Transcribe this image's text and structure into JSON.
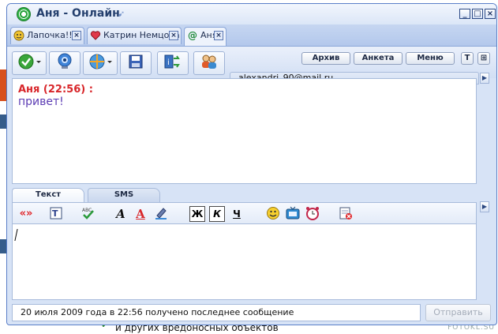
{
  "window": {
    "title": "Аня - Онлайн",
    "controls": [
      "_",
      "□",
      "×"
    ]
  },
  "tabs": [
    {
      "label": "Лапочка!!!",
      "icon": "smiley-status-icon"
    },
    {
      "label": "Катрин Немцова",
      "icon": "heart-status-icon"
    },
    {
      "label": "Аня",
      "icon": "at-status-icon",
      "active": true
    }
  ],
  "toolbar": {
    "buttons": [
      "status-check",
      "webcam",
      "globe-menu",
      "save",
      "info-transfer",
      "contacts"
    ],
    "archive_label": "Архив",
    "profile_label": "Анкета",
    "menu_label": "Меню",
    "font_btn": "T",
    "grid_btn": "⊞"
  },
  "chat": {
    "contact_email": "alexandri_90@mail.ru",
    "messages": [
      {
        "author": "Аня (22:56) :",
        "text": "привет!"
      }
    ]
  },
  "editor": {
    "tabs": [
      "Текст",
      "SMS"
    ],
    "active_tab": "Текст",
    "format": {
      "bold": "Ж",
      "italic": "К",
      "underline": "Ч"
    },
    "input_value": ""
  },
  "status": {
    "text": "20 июля 2009 года в 22:56 получено последнее сообщение"
  },
  "send_label": "Отправить",
  "background": {
    "bottom_text": "и других вредоносных объектов",
    "watermark": "FOTOKL.SU"
  },
  "colors": {
    "author": "#d8262a",
    "message": "#5b3bb3",
    "window_border": "#5a7fc8"
  }
}
